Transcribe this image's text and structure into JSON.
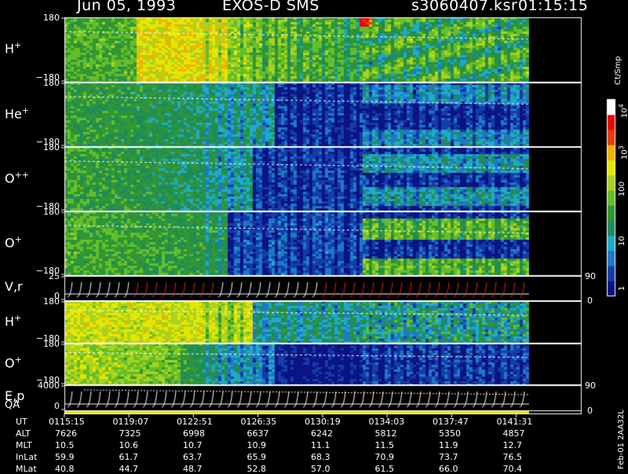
{
  "header": {
    "date": "Jun 05, 1993",
    "instrument": "EXOS-D SMS",
    "file": "s3060407.ksr",
    "time": "01:15:15"
  },
  "colors": {
    "background": "#000000",
    "dark_blue": "#0d1a8a",
    "cyan": "#1aa7c9",
    "green": "#3fa23a",
    "yellow": "#e6e600",
    "red": "#e01010",
    "white": "#ffffff"
  },
  "chart_data": {
    "type": "heatmap",
    "panels": [
      {
        "label": "H",
        "charge": "+",
        "y_top": "180",
        "y_bottom": "−180"
      },
      {
        "label": "He",
        "charge": "+",
        "y_top": "180",
        "y_bottom": "−180"
      },
      {
        "label": "O",
        "charge": "++",
        "y_top": "180",
        "y_bottom": "−180"
      },
      {
        "label": "O",
        "charge": "+",
        "y_top": "180",
        "y_bottom": "−180"
      },
      {
        "label": "V,r",
        "charge": "",
        "y_top": "25",
        "y_bottom": "0",
        "r_top": "90",
        "r_bottom": "0"
      },
      {
        "label": "H",
        "charge": "+",
        "y_top": "180",
        "y_bottom": "−180"
      },
      {
        "label": "O",
        "charge": "+",
        "y_top": "180",
        "y_bottom": "−180"
      },
      {
        "label": "E,p",
        "charge": "",
        "y_top": "4000",
        "y_bottom": "0",
        "r_top": "90",
        "r_bottom": "0"
      }
    ],
    "qa_label": "QA",
    "colorbar": {
      "unit": "Ct/Smp",
      "labels": [
        "10",
        "10",
        "100",
        "10",
        "1"
      ],
      "label_exponents": [
        "4",
        "3",
        "",
        "",
        ""
      ]
    },
    "footer_rows": [
      {
        "name": "UT",
        "values": [
          "0115:15",
          "0119:07",
          "0122:51",
          "0126:35",
          "0130:19",
          "0134:03",
          "0137:47",
          "0141:31"
        ]
      },
      {
        "name": "ALT",
        "values": [
          "7626",
          "7325",
          "6998",
          "6637",
          "6242",
          "5812",
          "5350",
          "4857"
        ]
      },
      {
        "name": "MLT",
        "values": [
          "10.5",
          "10.6",
          "10.7",
          "10.9",
          "11.1",
          "11.5",
          "11.9",
          "12.7"
        ]
      },
      {
        "name": "InLat",
        "values": [
          "59.9",
          "61.7",
          "63.7",
          "65.9",
          "68.3",
          "70.9",
          "73.7",
          "76.5"
        ]
      },
      {
        "name": "MLat",
        "values": [
          "40.8",
          "44.7",
          "48.7",
          "52.8",
          "57.0",
          "61.5",
          "66.0",
          "70.4"
        ]
      }
    ],
    "side_stamp": "Feb-01 2AA32L"
  }
}
